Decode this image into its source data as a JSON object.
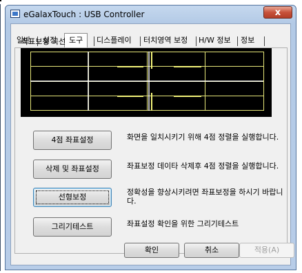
{
  "window": {
    "title": "eGalaxTouch : USB Controller",
    "close_glyph": "x"
  },
  "tabs": [
    {
      "label": "일반",
      "active": false
    },
    {
      "label": "설정",
      "active": false
    },
    {
      "label": "도구",
      "active": true
    },
    {
      "label": "디스플레이",
      "active": false
    },
    {
      "label": "터치영역 보정",
      "active": false
    },
    {
      "label": "H/W 정보",
      "active": false
    },
    {
      "label": "정보",
      "active": false
    }
  ],
  "panel": {
    "group_label": "좌표보정 곡선",
    "curve_colors": {
      "background": "#000000",
      "grid": "#e8e87a",
      "curve": "#ffffff"
    },
    "actions": [
      {
        "button": "4점 좌표설정",
        "description": "화면을 일치시키기 위해 4점 정렬을 실행합니다."
      },
      {
        "button": "삭제 및 좌표설정",
        "description": "좌표보정 데이타 삭제후 4점 정렬을 실행합니다."
      },
      {
        "button": "선형보정",
        "description": "정확성을 향상시키려면 좌표보정을 하시기 바랍니다.",
        "focused": true
      },
      {
        "button": "그리기테스트",
        "description": "좌표설정 확인을 위한 그리기테스트"
      }
    ]
  },
  "footer": {
    "ok": "확인",
    "cancel": "취소",
    "apply": "적용(A)"
  }
}
